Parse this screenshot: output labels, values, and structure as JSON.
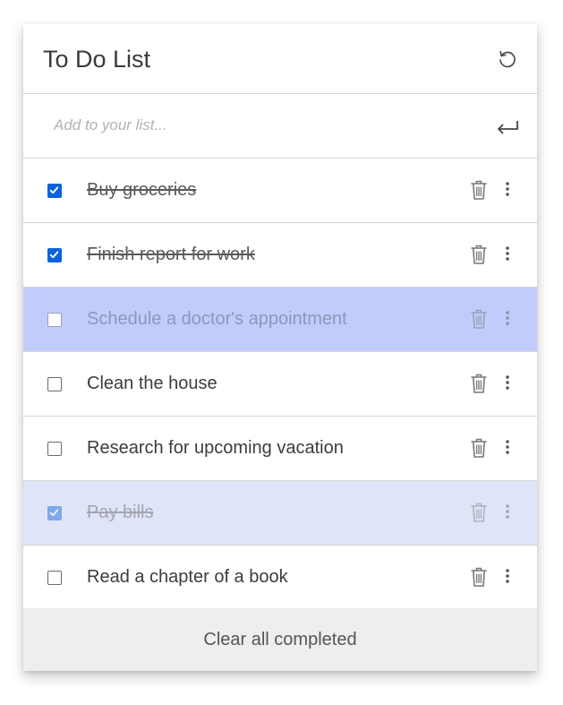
{
  "app": {
    "title": "To Do List"
  },
  "add": {
    "placeholder": "Add to your list..."
  },
  "items": [
    {
      "label": "Buy groceries",
      "checked": true,
      "state": "normal"
    },
    {
      "label": "Finish report for work",
      "checked": true,
      "state": "normal"
    },
    {
      "label": "Schedule a doctor's appointment",
      "checked": false,
      "state": "selected"
    },
    {
      "label": "Clean the house",
      "checked": false,
      "state": "normal"
    },
    {
      "label": "Research for upcoming vacation",
      "checked": false,
      "state": "normal"
    },
    {
      "label": "Pay bills",
      "checked": true,
      "state": "dragging"
    },
    {
      "label": "Read a chapter of a book",
      "checked": false,
      "state": "normal"
    }
  ],
  "footer": {
    "clear_label": "Clear all completed"
  },
  "icons": {
    "reset": "refresh-icon",
    "enter": "enter-return-icon",
    "delete": "trash-icon",
    "menu": "more-vertical-icon",
    "check": "checkmark-icon"
  },
  "colors": {
    "checkbox_checked": "#0b62dd",
    "selected_row": "#c1ccfb",
    "dragging_row": "#dfe4f8",
    "footer_bg": "#eeeeee"
  }
}
